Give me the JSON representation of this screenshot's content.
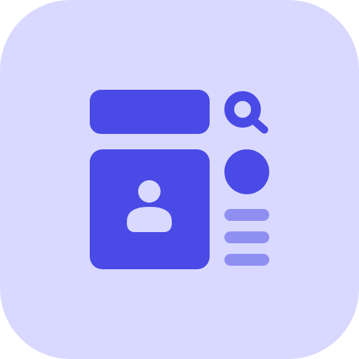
{
  "icon": {
    "name": "profile-search-layout-icon",
    "colors": {
      "tile_background": "#D9D9FF",
      "primary": "#4A4AE6",
      "secondary": "#8F8FF2",
      "person": "#D9D9FF"
    }
  }
}
